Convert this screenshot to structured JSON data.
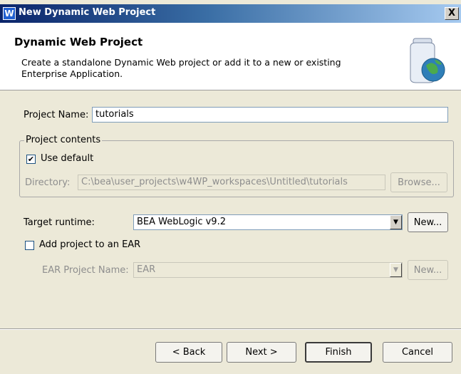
{
  "window": {
    "title": "New Dynamic Web Project",
    "close_symbol": "X"
  },
  "header": {
    "title": "Dynamic Web Project",
    "description": "Create a standalone Dynamic Web project or add it to a new or existing Enterprise Application."
  },
  "project_name": {
    "label": "Project Name:",
    "value": "tutorials"
  },
  "project_contents": {
    "legend": "Project contents",
    "use_default_label": "Use default",
    "use_default_checked": true,
    "directory_label": "Directory:",
    "directory_value": "C:\\bea\\user_projects\\w4WP_workspaces\\Untitled\\tutorials",
    "browse_label": "Browse..."
  },
  "target_runtime": {
    "label": "Target runtime:",
    "value": "BEA WebLogic v9.2",
    "new_label": "New..."
  },
  "ear": {
    "add_label": "Add project to an EAR",
    "add_checked": false,
    "name_label": "EAR Project Name:",
    "name_value": "EAR",
    "new_label": "New..."
  },
  "footer": {
    "back_label": "< Back",
    "next_label": "Next >",
    "finish_label": "Finish",
    "cancel_label": "Cancel"
  }
}
